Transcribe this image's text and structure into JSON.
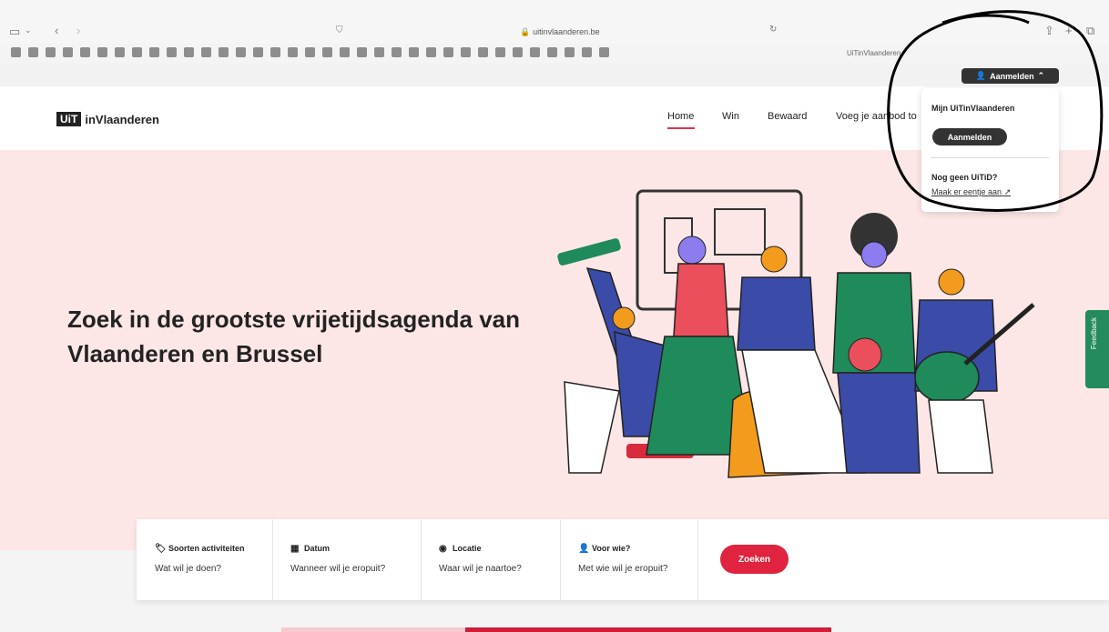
{
  "browser": {
    "url": "🔒 uitinvlaanderen.be",
    "tab_title": "UiTinVlaanderen"
  },
  "colors": {
    "accent": "#e0243f",
    "hero_bg": "#fde7e6",
    "feedback": "#238b5c",
    "dark": "#333333"
  },
  "header": {
    "logo_uit": "UiT",
    "logo_rest": "inVlaanderen",
    "nav": [
      "Home",
      "Win",
      "Bewaard",
      "Voeg je aanbod to"
    ]
  },
  "account": {
    "login_label": "Aanmelden",
    "dropdown_title": "Mijn UiTinVlaanderen",
    "dropdown_login": "Aanmelden",
    "no_account": "Nog geen UiTiD?",
    "create_link": "Maak er eentje aan"
  },
  "hero": {
    "title": "Zoek in de grootste vrijetijdsagenda van Vlaanderen en Brussel"
  },
  "search": {
    "fields": [
      {
        "icon": "tag-icon",
        "label": "Soorten activiteiten",
        "value": "Wat wil je doen?"
      },
      {
        "icon": "calendar-icon",
        "label": "Datum",
        "value": "Wanneer wil je eropuit?"
      },
      {
        "icon": "location-icon",
        "label": "Locatie",
        "value": "Waar wil je naartoe?"
      },
      {
        "icon": "user-icon",
        "label": "Voor wie?",
        "value": "Met wie wil je eropuit?"
      }
    ],
    "submit": "Zoeken"
  },
  "feedback": {
    "label": "Feedback"
  }
}
